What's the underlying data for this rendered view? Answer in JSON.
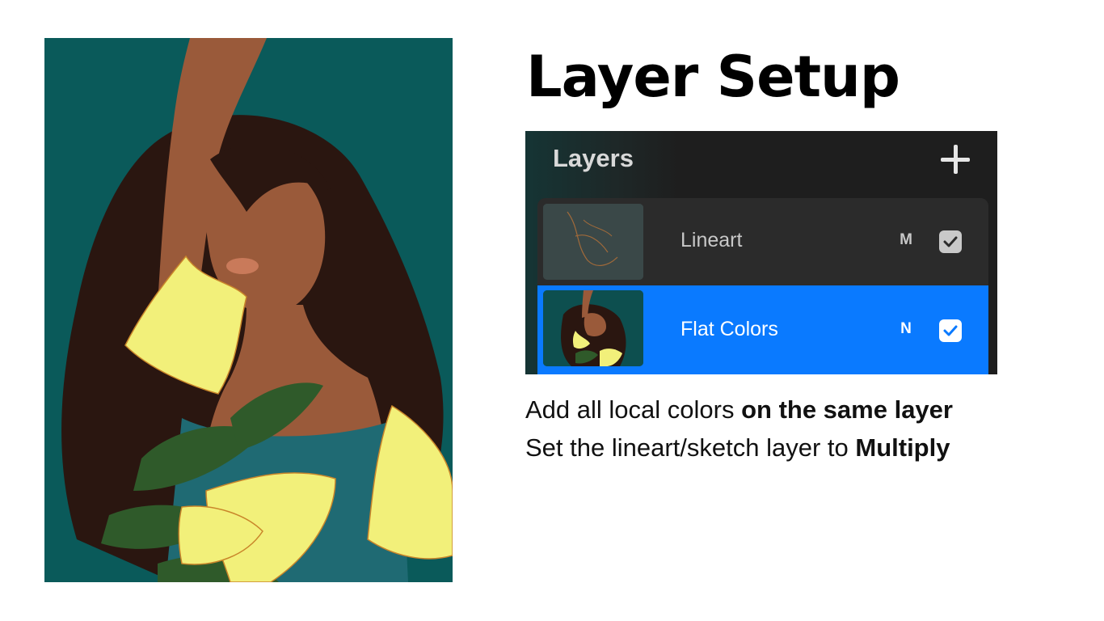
{
  "slide": {
    "title": "Layer Setup",
    "captions": [
      {
        "prefix": "Add all local colors ",
        "emphasis": "on the same layer"
      },
      {
        "prefix": "Set the lineart/sketch layer to ",
        "emphasis": "Multiply"
      }
    ]
  },
  "layers_panel": {
    "title": "Layers",
    "add_icon": "plus-icon",
    "layers": [
      {
        "name": "Lineart",
        "blend_mode": "M",
        "visible": true,
        "selected": false
      },
      {
        "name": "Flat Colors",
        "blend_mode": "N",
        "visible": true,
        "selected": true
      }
    ],
    "colors": {
      "panel_bg": "#1e1e1e",
      "row_bg": "#2b2b2b",
      "selected_bg": "#0a7aff"
    }
  },
  "artwork": {
    "colors": {
      "background": "#0a5a5a",
      "skin": "#9a5a3a",
      "hair": "#2a1610",
      "flower": "#f2f07a",
      "leaf": "#2f5a2a",
      "dress": "#1f6a73"
    }
  }
}
